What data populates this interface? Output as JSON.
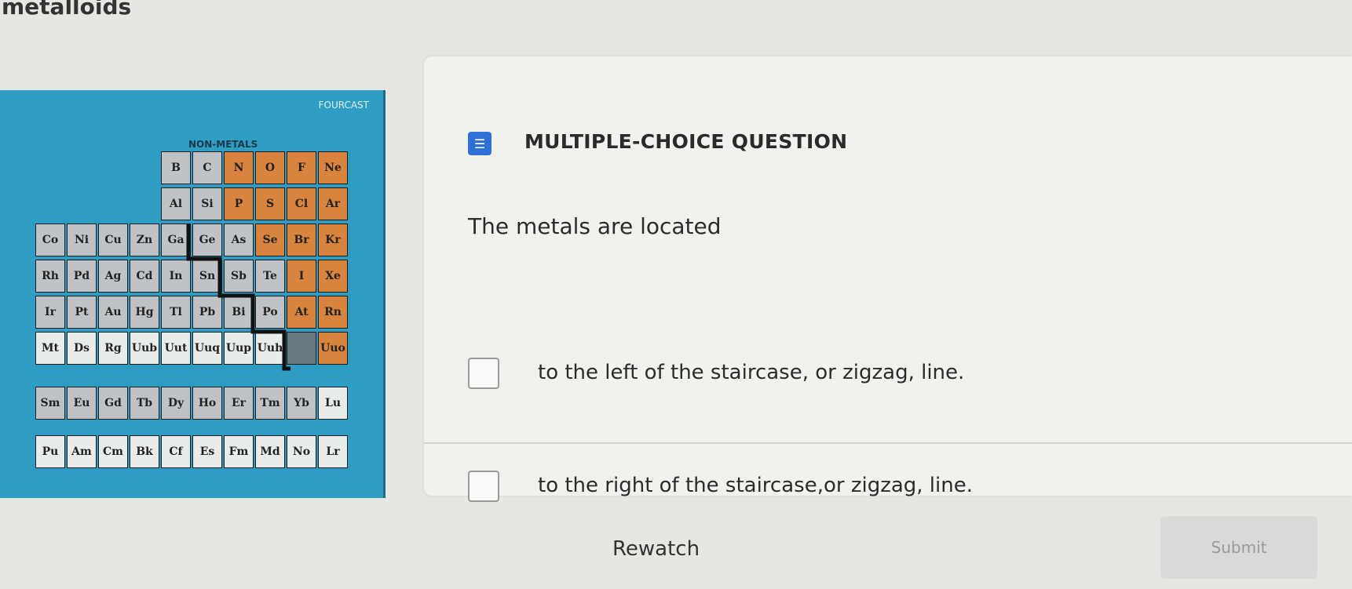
{
  "header": {
    "title": "metalloids"
  },
  "image": {
    "brand": "FOURCAST",
    "nonmetals_label": "NON-METALS",
    "elements_row1": [
      "B",
      "C",
      "N",
      "O",
      "F",
      "Ne"
    ],
    "elements_row2": [
      "Al",
      "Si",
      "P",
      "S",
      "Cl",
      "Ar"
    ],
    "elements_row3": [
      "Co",
      "Ni",
      "Cu",
      "Zn",
      "Ga",
      "Ge",
      "As",
      "Se",
      "Br",
      "Kr"
    ],
    "elements_row4": [
      "Rh",
      "Pd",
      "Ag",
      "Cd",
      "In",
      "Sn",
      "Sb",
      "Te",
      "I",
      "Xe"
    ],
    "elements_row5": [
      "Ir",
      "Pt",
      "Au",
      "Hg",
      "Tl",
      "Pb",
      "Bi",
      "Po",
      "At",
      "Rn"
    ],
    "elements_row6": [
      "Mt",
      "Ds",
      "Rg",
      "Uub",
      "Uut",
      "Uuq",
      "Uup",
      "Uuh",
      "",
      "Uuo"
    ],
    "lanthanides": [
      "Sm",
      "Eu",
      "Gd",
      "Tb",
      "Dy",
      "Ho",
      "Er",
      "Tm",
      "Yb",
      "Lu"
    ],
    "actinides": [
      "Pu",
      "Am",
      "Cm",
      "Bk",
      "Cf",
      "Es",
      "Fm",
      "Md",
      "No",
      "Lr"
    ]
  },
  "question": {
    "type_label": "MULTIPLE-CHOICE QUESTION",
    "icon": "list-icon",
    "text": "The metals are located",
    "options": [
      {
        "label": "to the left of the staircase, or zigzag, line.",
        "checked": false
      },
      {
        "label": "to the right of the staircase,or zigzag, line.",
        "checked": false
      }
    ]
  },
  "footer": {
    "rewatch_label": "Rewatch",
    "submit_label": "Submit"
  },
  "colors": {
    "accent": "#2f6fd8",
    "image_background": "#2e9dc4",
    "nonmetal_cells": "#d8843e"
  }
}
